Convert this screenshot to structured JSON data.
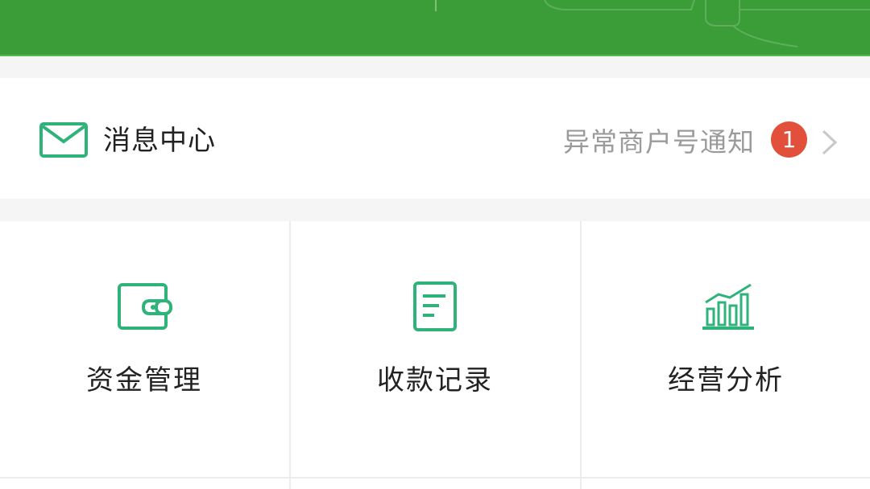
{
  "message_center": {
    "title": "消息中心",
    "notice": "异常商户号通知",
    "badge_count": "1"
  },
  "tiles": [
    {
      "label": "资金管理",
      "icon": "wallet-icon"
    },
    {
      "label": "收款记录",
      "icon": "document-icon"
    },
    {
      "label": "经营分析",
      "icon": "bar-chart-icon"
    }
  ],
  "colors": {
    "banner": "#3a9d38",
    "accent_icon": "#2fb37a",
    "badge": "#e2503c"
  }
}
